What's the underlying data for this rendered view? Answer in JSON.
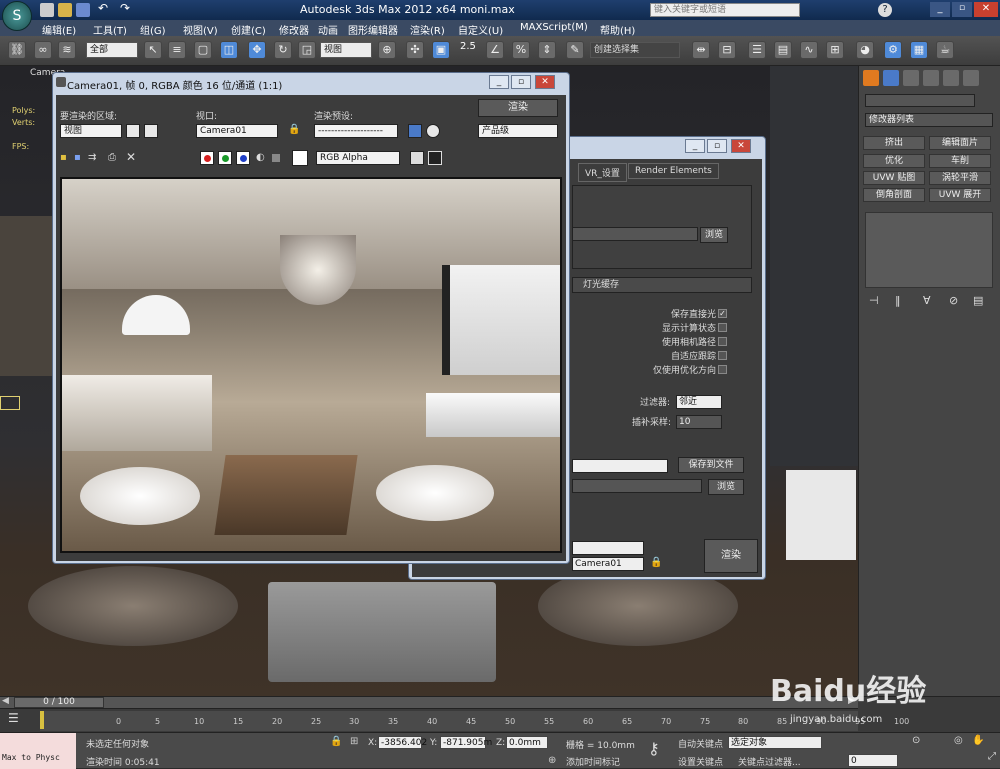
{
  "app": {
    "title": "Autodesk 3ds Max  2012 x64        moni.max",
    "search_placeholder": "键入关键字或短语"
  },
  "menu": [
    "编辑(E)",
    "工具(T)",
    "组(G)",
    "视图(V)",
    "创建(C)",
    "修改器",
    "动画",
    "图形编辑器",
    "渲染(R)",
    "自定义(U)",
    "MAXScript(M)",
    "帮助(H)"
  ],
  "toolbar": {
    "selection_filter": "全部",
    "ref_coord": "视图",
    "snap_label": "2.5",
    "named_selection": "创建选择集"
  },
  "viewport": {
    "label": "Camera",
    "stats": [
      "Polys:",
      "Verts:",
      "FPS:"
    ]
  },
  "render_window": {
    "title": "Camera01, 帧 0, RGBA 颜色 16 位/通道 (1:1)",
    "area_label": "要渲染的区域:",
    "area_value": "视图",
    "viewport_label": "视口:",
    "viewport_value": "Camera01",
    "preset_label": "渲染预设:",
    "preset_value": "--------------------",
    "render_button": "渲染",
    "quality_value": "产品级",
    "channel_value": "RGB Alpha"
  },
  "setup_window": {
    "tabs": [
      "VR_设置",
      "Render Elements"
    ],
    "browse": "浏览",
    "section_light_cache": "灯光缓存",
    "options": [
      {
        "label": "保存直接光",
        "checked": true
      },
      {
        "label": "显示计算状态",
        "checked": false
      },
      {
        "label": "使用相机路径",
        "checked": false
      },
      {
        "label": "自适应跟踪",
        "checked": false
      },
      {
        "label": "仅使用优化方向",
        "checked": false
      }
    ],
    "filter_label": "过滤器:",
    "filter_value": "邻近",
    "interp_label": "插补采样:",
    "interp_value": "10",
    "save_to_file": "保存到文件",
    "browse2": "浏览",
    "camera_value": "Camera01",
    "render_button": "渲染"
  },
  "right_panel": {
    "modifier_list": "修改器列表",
    "buttons": [
      "挤出",
      "编辑面片",
      "优化",
      "车削",
      "UVW 贴图",
      "涡轮平滑",
      "倒角剖面",
      "UVW 展开"
    ]
  },
  "timeline": {
    "frame": "0 / 100",
    "ticks": [
      "0",
      "5",
      "10",
      "15",
      "20",
      "25",
      "30",
      "35",
      "40",
      "45",
      "50",
      "55",
      "60",
      "65",
      "70",
      "75",
      "80",
      "85",
      "90",
      "95",
      "100"
    ]
  },
  "status": {
    "script_label": "Max to Physc",
    "message": "未选定任何对象",
    "render_time": "渲染时间  0:05:41",
    "x": "-3856.402",
    "y": "-871.905m",
    "z": "0.0mm",
    "grid": "栅格 = 10.0mm",
    "add_time_tag": "添加时间标记",
    "auto_key": "自动关键点",
    "set_key": "设置关键点",
    "selected_object": "选定对象",
    "key_filter": "关键点过滤器...",
    "frame_field": "0"
  },
  "watermark": {
    "brand": "Baidu经验",
    "url": "jingyan.baidu.com"
  },
  "colors": {
    "title_bg": "#102a4e",
    "render_red": "#d62020",
    "render_green": "#1a9a2a",
    "render_blue": "#2040c8"
  }
}
